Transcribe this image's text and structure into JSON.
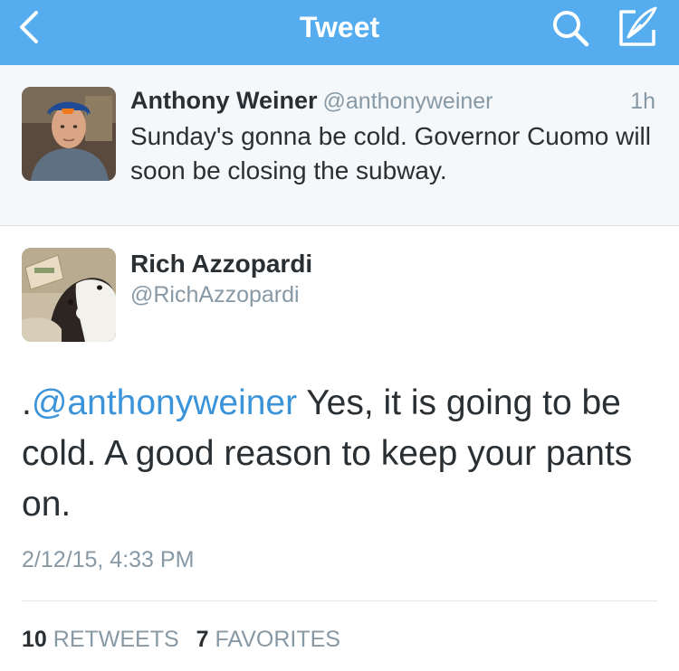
{
  "header": {
    "title": "Tweet",
    "bg_color": "#55acee",
    "back_icon": "chevron-left-icon",
    "search_icon": "search-icon",
    "compose_icon": "compose-icon"
  },
  "reply_to": {
    "name": "Anthony Weiner",
    "handle": "@anthonyweiner",
    "time": "1h",
    "text": "Sunday's gonna be cold.  Governor Cuomo will soon be closing the subway."
  },
  "tweet": {
    "name": "Rich Azzopardi",
    "handle": "@RichAzzopardi",
    "text_prefix": ".",
    "mention": "@anthonyweiner",
    "text_body": " Yes, it is going to be cold. A good reason to keep your pants on.",
    "date": "2/12/15, 4:33 PM",
    "retweets_count": "10",
    "retweets_label": "RETWEETS",
    "favorites_count": "7",
    "favorites_label": "FAVORITES"
  },
  "colors": {
    "link": "#3b94d9",
    "muted": "#8899a6",
    "text": "#292f33"
  }
}
